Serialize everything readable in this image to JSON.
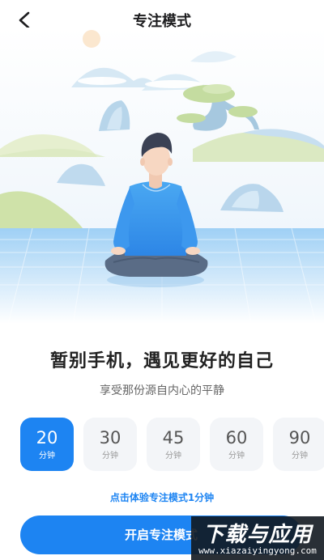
{
  "header": {
    "title": "专注模式"
  },
  "main": {
    "headline": "暂别手机，遇见更好的自己",
    "subline": "享受那份源自内心的平静",
    "durations": [
      {
        "value": "20",
        "unit": "分钟",
        "selected": true
      },
      {
        "value": "30",
        "unit": "分钟",
        "selected": false
      },
      {
        "value": "45",
        "unit": "分钟",
        "selected": false
      },
      {
        "value": "60",
        "unit": "分钟",
        "selected": false
      },
      {
        "value": "90",
        "unit": "分钟",
        "selected": false
      }
    ],
    "trial_link": "点击体验专注模式1分钟",
    "start_button": "开启专注模式"
  },
  "watermark": {
    "main": "下载与应用",
    "sub": "www.xiazaiyingyong.com"
  },
  "colors": {
    "accent": "#1d84f2",
    "option_bg": "#f3f5f8"
  },
  "icons": {
    "back": "chevron-left-icon"
  }
}
